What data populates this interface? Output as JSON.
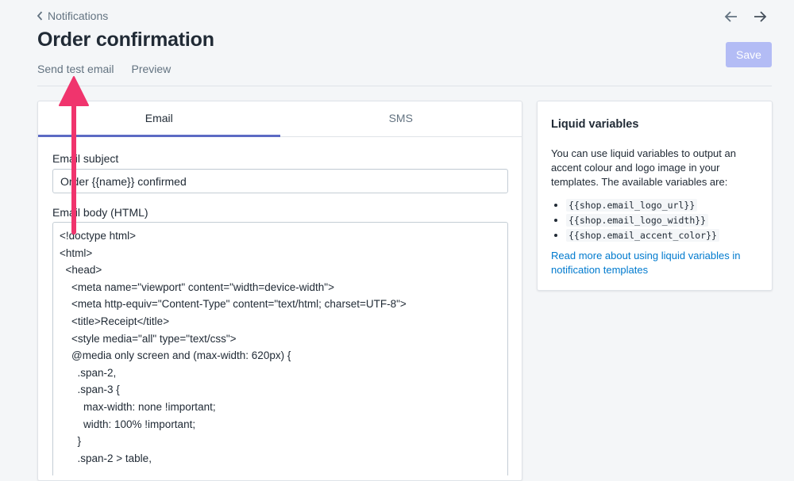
{
  "header": {
    "breadcrumb": "Notifications",
    "title": "Order confirmation",
    "actions": [
      "Send test email",
      "Preview"
    ],
    "save_label": "Save"
  },
  "tabs": [
    {
      "label": "Email",
      "active": true
    },
    {
      "label": "SMS",
      "active": false
    }
  ],
  "form": {
    "subject_label": "Email subject",
    "subject_value": "Order {{name}} confirmed",
    "body_label": "Email body (HTML)",
    "body_lines": [
      "<!doctype html>",
      "<html>",
      "  <head>",
      "    <meta name=\"viewport\" content=\"width=device-width\">",
      "    <meta http-equiv=\"Content-Type\" content=\"text/html; charset=UTF-8\">",
      "    <title>Receipt</title>",
      "    <style media=\"all\" type=\"text/css\">",
      "    @media only screen and (max-width: 620px) {",
      "      .span-2,",
      "      .span-3 {",
      "        max-width: none !important;",
      "        width: 100% !important;",
      "      }",
      "      .span-2 > table,"
    ]
  },
  "sidebar": {
    "title": "Liquid variables",
    "description": "You can use liquid variables to output an accent colour and logo image in your templates. The available variables are:",
    "variables": [
      "{{shop.email_logo_url}}",
      "{{shop.email_logo_width}}",
      "{{shop.email_accent_color}}"
    ],
    "link_text": "Read more about using liquid variables in notification templates"
  },
  "colors": {
    "accent": "#5c6ac4",
    "save_disabled": "#b3bcf5",
    "link": "#007ace",
    "annotation_arrow": "#f0346d"
  }
}
